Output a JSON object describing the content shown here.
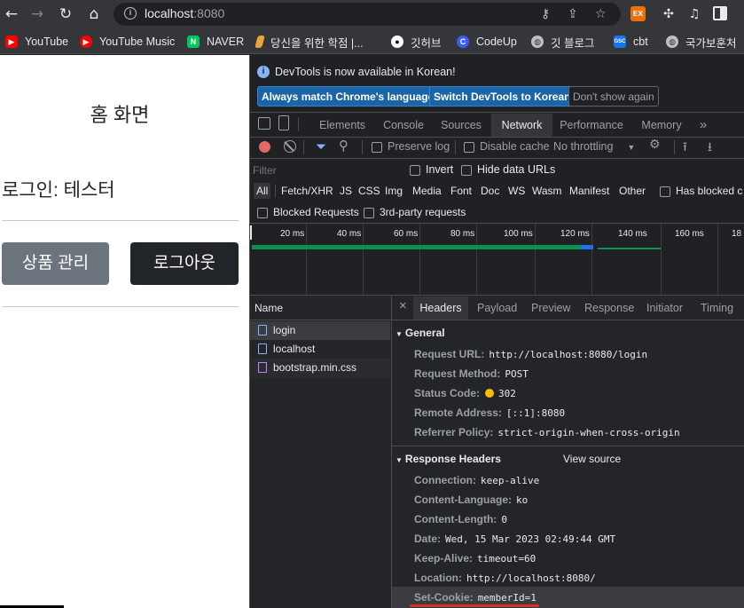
{
  "browser": {
    "url_host": "localhost",
    "url_port": ":8080",
    "bookmarks": [
      {
        "label": "YouTube",
        "icon": "youtube-icon",
        "color": "#ff0000"
      },
      {
        "label": "YouTube Music",
        "icon": "youtube-music-icon",
        "color": "#ff0000"
      },
      {
        "label": "NAVER",
        "icon": "naver-icon",
        "color": "#03c75a"
      },
      {
        "label": "당신을 위한 학점 |...",
        "icon": "bookmark-site-icon",
        "color": "#e8a33d"
      },
      {
        "label": "깃허브",
        "icon": "github-icon",
        "color": "#ffffff"
      },
      {
        "label": "CodeUp",
        "icon": "codeup-icon",
        "color": "#3d5afe"
      },
      {
        "label": "깃 블로그",
        "icon": "globe-icon",
        "color": "#bdc1c6"
      },
      {
        "label": "cbt",
        "icon": "gsc-icon",
        "color": "#1a73e8"
      },
      {
        "label": "국가보훈처",
        "icon": "globe-icon",
        "color": "#bdc1c6"
      }
    ]
  },
  "page": {
    "title": "홈 화면",
    "login_text": "로그인: 테스터",
    "product_button": "상품 관리",
    "logout_button": "로그아웃"
  },
  "devtools": {
    "language_banner": "DevTools is now available in Korean!",
    "btn_match": "Always match Chrome's language",
    "btn_switch": "Switch DevTools to Korean",
    "btn_dont_show": "Don't show again",
    "tabs": [
      "Elements",
      "Console",
      "Sources",
      "Network",
      "Performance",
      "Memory"
    ],
    "active_tab": "Network",
    "preserve_log": "Preserve log",
    "disable_cache": "Disable cache",
    "throttling": "No throttling",
    "filter_placeholder": "Filter",
    "invert": "Invert",
    "hide_data_urls": "Hide data URLs",
    "filter_types": [
      "All",
      "Fetch/XHR",
      "JS",
      "CSS",
      "Img",
      "Media",
      "Font",
      "Doc",
      "WS",
      "Wasm",
      "Manifest",
      "Other"
    ],
    "has_blocked": "Has blocked c",
    "blocked_requests": "Blocked Requests",
    "third_party": "3rd-party requests",
    "timeline_ticks": [
      "20 ms",
      "40 ms",
      "60 ms",
      "80 ms",
      "100 ms",
      "120 ms",
      "140 ms",
      "160 ms",
      "18"
    ],
    "name_header": "Name",
    "requests": [
      "login",
      "localhost",
      "bootstrap.min.css"
    ],
    "detail_tabs": [
      "Headers",
      "Payload",
      "Preview",
      "Response",
      "Initiator",
      "Timing"
    ],
    "close_glyph": "×",
    "general_title": "General",
    "general": [
      {
        "key": "Request URL:",
        "value": "http://localhost:8080/login"
      },
      {
        "key": "Request Method:",
        "value": "POST"
      },
      {
        "key": "Status Code:",
        "value": "302"
      },
      {
        "key": "Remote Address:",
        "value": "[::1]:8080"
      },
      {
        "key": "Referrer Policy:",
        "value": "strict-origin-when-cross-origin"
      }
    ],
    "response_headers_title": "Response Headers",
    "view_source": "View source",
    "response_headers": [
      {
        "key": "Connection:",
        "value": "keep-alive"
      },
      {
        "key": "Content-Language:",
        "value": "ko"
      },
      {
        "key": "Content-Length:",
        "value": "0"
      },
      {
        "key": "Date:",
        "value": "Wed, 15 Mar 2023 02:49:44 GMT"
      },
      {
        "key": "Keep-Alive:",
        "value": "timeout=60"
      },
      {
        "key": "Location:",
        "value": "http://localhost:8080/"
      },
      {
        "key": "Set-Cookie:",
        "value": "memberId=1"
      }
    ],
    "accent": "#8ab4f8",
    "status_dot_color": "#fbbc04"
  }
}
